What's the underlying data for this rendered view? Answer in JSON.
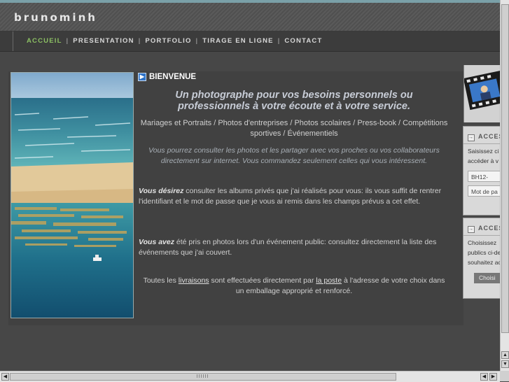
{
  "header": {
    "brand": "brunominh"
  },
  "nav": {
    "items": [
      "ACCUEIL",
      "PRESENTATION",
      "PORTFOLIO",
      "TIRAGE EN LIGNE",
      "CONTACT"
    ],
    "separator": "|",
    "active_color": "#8cc063"
  },
  "content": {
    "title": "BIENVENUE",
    "title_icon": "arrow-right-icon",
    "tagline": "Un photographe pour vos besoins personnels ou professionnels à votre écoute et à votre service.",
    "services": "Mariages et Portraits / Photos d'entreprises / Photos scolaires / Press-book / Compétitions sportives / Événementiels",
    "intro": "Vous pourrez consulter les photos et les partager avec vos proches ou vos collaborateurs directement sur internet. Vous commandez seulement celles qui vous intéressent.",
    "para_desire_lead": "Vous désirez",
    "para_desire_text": " consulter les albums privés que j'ai réalisés pour vous: ils vous suffit de rentrer l'identifiant et le mot de passe que je vous ai remis dans les champs prévus a cet effet.",
    "para_avez_lead": "Vous avez",
    "para_avez_text": " été pris en photos lors d'un événement public: consultez directement la liste des événements que j'ai couvert.",
    "delivery_prefix": "Toutes les ",
    "delivery_link1": "livraisons",
    "delivery_mid": " sont effectuées directement par ",
    "delivery_link2": "la poste",
    "delivery_suffix": " à l'adresse de votre choix dans un emballage approprié et renforcé."
  },
  "sidebar": {
    "box1": {
      "title": "ACCES",
      "text_lines": [
        "Saisissez ci",
        "accéder à v"
      ],
      "login_value": "BH12-",
      "password_placeholder": "Mot de pa"
    },
    "box2": {
      "title": "ACCES",
      "text_lines": [
        "Choisissez",
        "publics ci-de",
        "souhaitez ac"
      ],
      "button_label": "Choisi"
    }
  },
  "scrollbar": {
    "up": "▲",
    "down": "▼",
    "left": "◀",
    "right": "▶"
  }
}
